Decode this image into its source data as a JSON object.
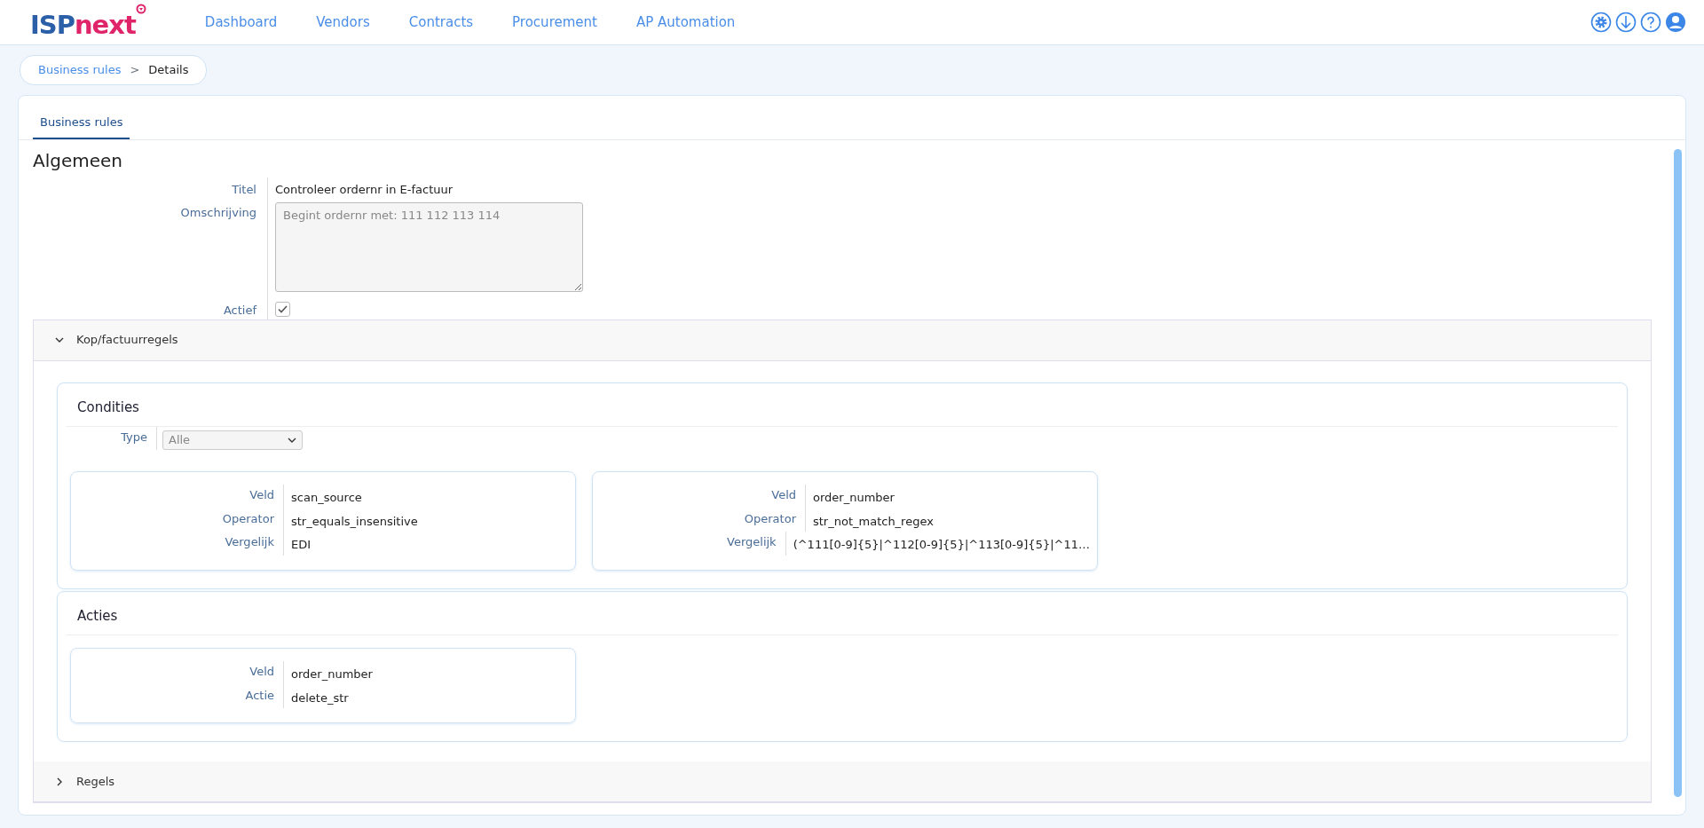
{
  "logo": {
    "part_1": "ISP",
    "part_2": "next"
  },
  "menu": [
    {
      "label": "Dashboard"
    },
    {
      "label": "Vendors"
    },
    {
      "label": "Contracts"
    },
    {
      "label": "Procurement"
    },
    {
      "label": "AP Automation"
    }
  ],
  "breadcrumb": [
    {
      "label": "Business rules",
      "kind": "link"
    },
    {
      "label": ">",
      "kind": "separator"
    },
    {
      "label": "Details",
      "kind": "current"
    }
  ],
  "tabs": [
    {
      "label": "Business rules",
      "selected": true
    }
  ],
  "section": {
    "title": "Algemeen",
    "fields": [
      {
        "label": "Titel",
        "kind": "text",
        "value": "Controleer ordernr in E-factuur"
      },
      {
        "label": "Omschrijving",
        "kind": "textarea",
        "value": "Begint ordernr met: 111 112 113 114",
        "disabled": true
      },
      {
        "label": "Actief",
        "kind": "checkbox",
        "checked": true
      }
    ]
  },
  "accordions": [
    {
      "title": "Kop/factuurregels",
      "expanded": true,
      "groups": [
        {
          "title": "Condities",
          "type_field": {
            "label": "Type",
            "value": "Alle"
          },
          "cards": [
            {
              "rows": [
                {
                  "label": "Veld",
                  "value": "scan_source"
                },
                {
                  "label": "Operator",
                  "value": "str_equals_insensitive"
                },
                {
                  "label": "Vergelijk",
                  "value": "EDI"
                }
              ]
            },
            {
              "rows": [
                {
                  "label": "Veld",
                  "value": "order_number"
                },
                {
                  "label": "Operator",
                  "value": "str_not_match_regex"
                },
                {
                  "label": "Vergelijk",
                  "value": "(^111[0-9]{5}|^112[0-9]{5}|^113[0-9]{5}|^11…"
                }
              ]
            }
          ]
        },
        {
          "title": "Acties",
          "cards": [
            {
              "rows": [
                {
                  "label": "Veld",
                  "value": "order_number"
                },
                {
                  "label": "Actie",
                  "value": "delete_str"
                }
              ]
            }
          ]
        }
      ]
    },
    {
      "title": "Regels",
      "expanded": false
    }
  ]
}
